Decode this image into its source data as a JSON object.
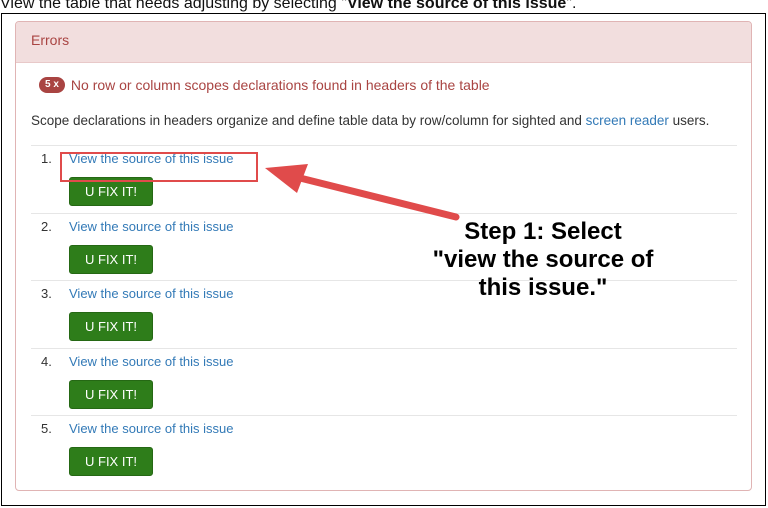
{
  "caption": {
    "prefix": "View the table that needs adjusting by selecting \"",
    "bold": "View the source of this issue",
    "suffix": "\"."
  },
  "panel": {
    "heading": "Errors",
    "issue": {
      "badge": "5 x",
      "text": "No row or column scopes declarations found in headers of the table"
    },
    "description": {
      "before": "Scope declarations in headers organize and define table data by row/column for sighted and ",
      "link": "screen reader",
      "after": " users."
    },
    "items": [
      {
        "number": "1.",
        "link": "View the source of this issue",
        "button": "U FIX IT!"
      },
      {
        "number": "2.",
        "link": "View the source of this issue",
        "button": "U FIX IT!"
      },
      {
        "number": "3.",
        "link": "View the source of this issue",
        "button": "U FIX IT!"
      },
      {
        "number": "4.",
        "link": "View the source of this issue",
        "button": "U FIX IT!"
      },
      {
        "number": "5.",
        "link": "View the source of this issue",
        "button": "U FIX IT!"
      }
    ]
  },
  "annotation": {
    "text": "Step 1: Select\n\"view the source of\nthis issue.\"",
    "color": "#e04b4b"
  }
}
